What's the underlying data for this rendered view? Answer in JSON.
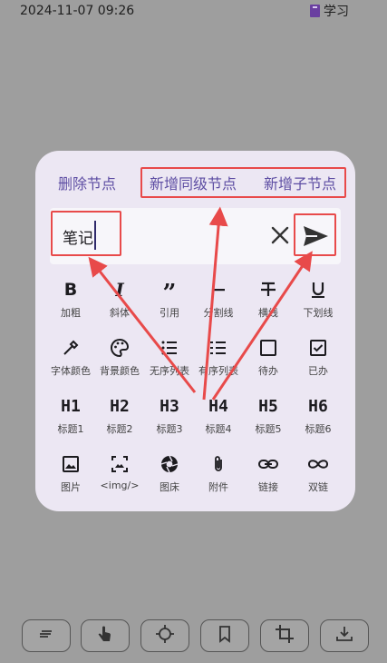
{
  "status": {
    "datetime": "2024-11-07 09:26",
    "app_label": "学习"
  },
  "node_actions": {
    "delete": "删除节点",
    "add_sibling": "新增同级节点",
    "add_child": "新增子节点"
  },
  "input": {
    "value": "笔记"
  },
  "toolbar": [
    {
      "label": "加粗",
      "icon": "bold-icon"
    },
    {
      "label": "斜体",
      "icon": "italic-icon"
    },
    {
      "label": "引用",
      "icon": "quote-icon"
    },
    {
      "label": "分割线",
      "icon": "divider-icon"
    },
    {
      "label": "横线",
      "icon": "strikethrough-icon"
    },
    {
      "label": "下划线",
      "icon": "underline-icon"
    },
    {
      "label": "字体颜色",
      "icon": "eyedropper-icon"
    },
    {
      "label": "背景颜色",
      "icon": "palette-icon"
    },
    {
      "label": "无序列表",
      "icon": "bullet-list-icon"
    },
    {
      "label": "有序列表",
      "icon": "ordered-list-icon"
    },
    {
      "label": "待办",
      "icon": "checkbox-empty-icon"
    },
    {
      "label": "已办",
      "icon": "checkbox-checked-icon"
    },
    {
      "label": "标题1",
      "glyph": "H1"
    },
    {
      "label": "标题2",
      "glyph": "H2"
    },
    {
      "label": "标题3",
      "glyph": "H3"
    },
    {
      "label": "标题4",
      "glyph": "H4"
    },
    {
      "label": "标题5",
      "glyph": "H5"
    },
    {
      "label": "标题6",
      "glyph": "H6"
    },
    {
      "label": "图片",
      "icon": "image-icon"
    },
    {
      "label": "<img/>",
      "icon": "image-tag-icon"
    },
    {
      "label": "图床",
      "icon": "camera-aperture-icon"
    },
    {
      "label": "附件",
      "icon": "paperclip-icon"
    },
    {
      "label": "链接",
      "icon": "link-icon"
    },
    {
      "label": "双链",
      "icon": "infinity-icon"
    }
  ],
  "bottom_bar": [
    "notes-icon",
    "touch-icon",
    "locate-icon",
    "bookmark-icon",
    "crop-icon",
    "download-icon"
  ],
  "colors": {
    "accent": "#5d4da3",
    "highlight": "#e84a4a",
    "dialog_bg": "#ece7f3",
    "screen_bg": "#9e9e9e"
  }
}
